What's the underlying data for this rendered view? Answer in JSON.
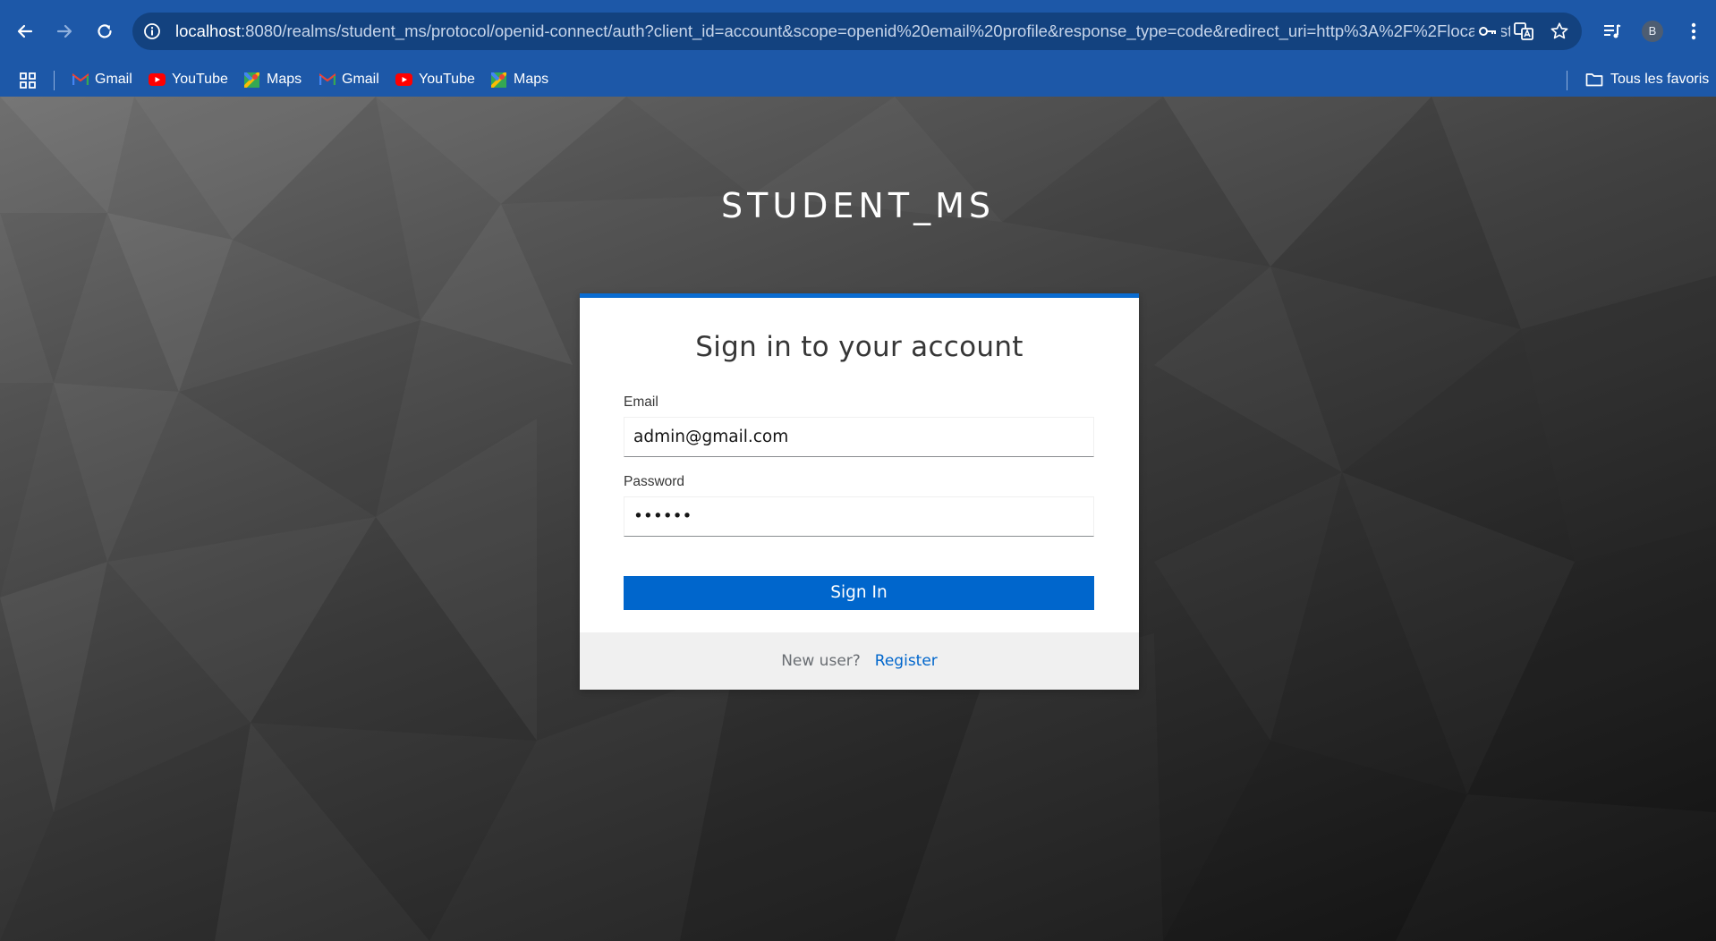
{
  "browser": {
    "url_host": "localhost",
    "url_rest": ":8080/realms/student_ms/protocol/openid-connect/auth?client_id=account&scope=openid%20email%20profile&response_type=code&redirect_uri=http%3A%2F%2Flocalhost...",
    "profile_initial": "B",
    "bookmarks": [
      {
        "label": "Gmail",
        "icon": "gmail-icon"
      },
      {
        "label": "YouTube",
        "icon": "youtube-icon"
      },
      {
        "label": "Maps",
        "icon": "maps-icon"
      },
      {
        "label": "Gmail",
        "icon": "gmail-icon"
      },
      {
        "label": "YouTube",
        "icon": "youtube-icon"
      },
      {
        "label": "Maps",
        "icon": "maps-icon"
      }
    ],
    "all_bookmarks_label": "Tous les favoris",
    "colors": {
      "toolbar": "#1d58a8",
      "omnibox": "#13427f"
    }
  },
  "login": {
    "realm_title": "STUDENT_MS",
    "heading": "Sign in to your account",
    "email_label": "Email",
    "email_value": "admin@gmail.com",
    "password_label": "Password",
    "password_value": "••••••",
    "submit_label": "Sign In",
    "new_user_text": "New user?",
    "register_label": "Register",
    "colors": {
      "accent": "#0066cc",
      "card_border": "#0a6cd1",
      "footer": "#f0f0f0"
    }
  }
}
